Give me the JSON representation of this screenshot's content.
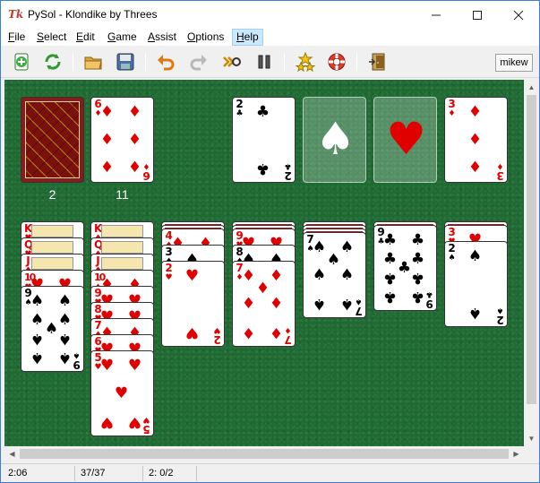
{
  "window": {
    "title": "PySol - Klondike by Threes",
    "app_icon_text": "Tk"
  },
  "menu": {
    "items": [
      {
        "label": "File",
        "u": "F",
        "rest": "ile"
      },
      {
        "label": "Select",
        "u": "S",
        "rest": "elect"
      },
      {
        "label": "Edit",
        "u": "E",
        "rest": "dit"
      },
      {
        "label": "Game",
        "u": "G",
        "rest": "ame"
      },
      {
        "label": "Assist",
        "u": "A",
        "rest": "ssist"
      },
      {
        "label": "Options",
        "u": "O",
        "rest": "ptions"
      },
      {
        "label": "Help",
        "u": "H",
        "rest": "elp"
      }
    ],
    "active": "Help"
  },
  "toolbar": {
    "buttons": [
      "new-game-icon",
      "restart-icon",
      "open-icon",
      "save-icon",
      "undo-icon",
      "redo-icon",
      "autodrop-icon",
      "pause-icon",
      "statistics-icon",
      "rules-icon",
      "quit-icon"
    ],
    "player": "mikew"
  },
  "colors": {
    "felt": "#1e6a32",
    "red_suit": "#e00000",
    "card_back": "#8b1a1a"
  },
  "table": {
    "stock_count": "2",
    "waste_count": "11",
    "waste_top": {
      "rank": "6",
      "suit": "♦"
    },
    "foundations": [
      {
        "rank": "2",
        "suit": "♣"
      },
      {
        "empty_suit": "♠"
      },
      {
        "empty_suit": "♥"
      },
      {
        "rank": "3",
        "suit": "♦"
      }
    ],
    "tableau": [
      [
        "K♥",
        "Q♥",
        "J♦",
        "10♥",
        "9♠"
      ],
      [
        "K♦",
        "Q♦",
        "J♦",
        "10♦",
        "9♥",
        "8♥",
        "7♦",
        "6♥",
        "5♥"
      ],
      [
        "4♦",
        "3♠",
        "2♥"
      ],
      [
        "9♥",
        "8♠",
        "7♦"
      ],
      [
        "7♠"
      ],
      [
        "9♣"
      ],
      [
        "3♥",
        "2♠"
      ]
    ]
  },
  "status": {
    "time": "2:06",
    "cards": "37/37",
    "moves": "2: 0/2"
  }
}
